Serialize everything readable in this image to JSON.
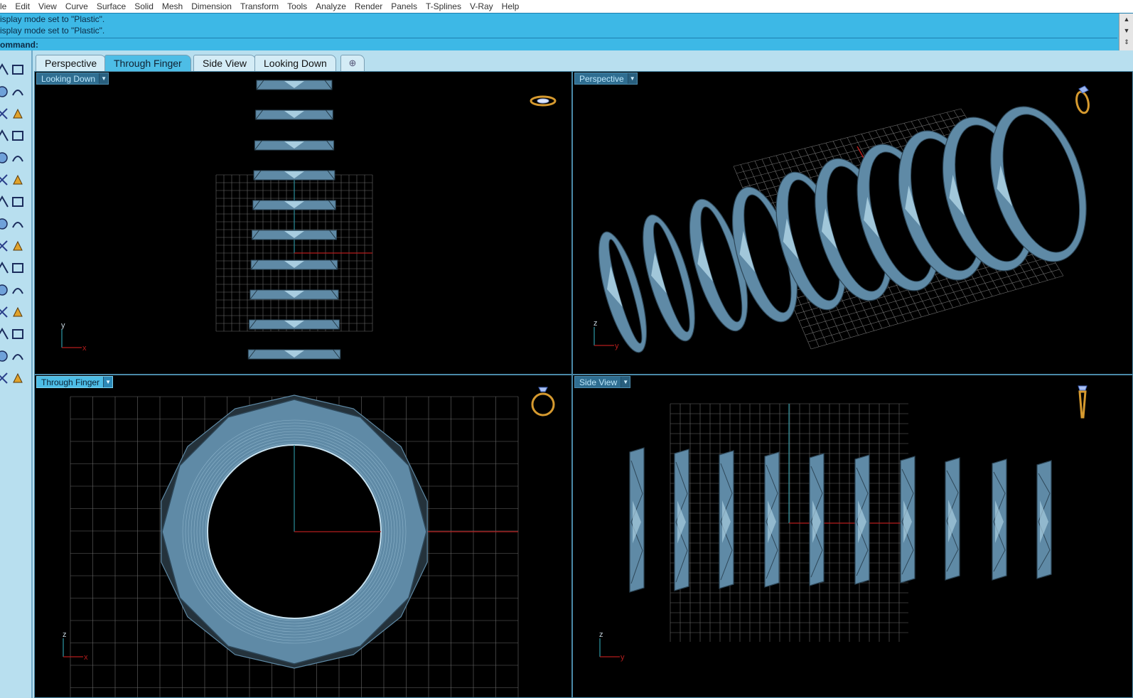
{
  "menu": {
    "items": [
      "le",
      "Edit",
      "View",
      "Curve",
      "Surface",
      "Solid",
      "Mesh",
      "Dimension",
      "Transform",
      "Tools",
      "Analyze",
      "Render",
      "Panels",
      "T-Splines",
      "V-Ray",
      "Help"
    ]
  },
  "command": {
    "history": [
      "isplay mode set to \"Plastic\".",
      "isplay mode set to \"Plastic\"."
    ],
    "prompt": "ommand:",
    "value": ""
  },
  "tabs": {
    "items": [
      "Perspective",
      "Through Finger",
      "Side View",
      "Looking Down"
    ],
    "active": "Through Finger",
    "add_label": "⊕"
  },
  "viewports": {
    "looking_down": {
      "label": "Looking Down",
      "axis_labels": [
        "y",
        "x"
      ]
    },
    "perspective": {
      "label": "Perspective",
      "axis_labels": [
        "z",
        "y"
      ]
    },
    "through_finger": {
      "label": "Through Finger",
      "axis_labels": [
        "z",
        "x"
      ]
    },
    "side_view": {
      "label": "Side View",
      "axis_labels": [
        "z",
        "y"
      ]
    }
  },
  "colors": {
    "ring_fill": "#5f8aa6",
    "ring_light": "#a8cde0",
    "ring_edge": "#2d4657",
    "grid": "#8c8c8c",
    "axis_x": "#b51d1d",
    "axis_y": "#2a8e9a",
    "ui_blue": "#3db8e6",
    "panel": "#b8dfef",
    "nav_gold": "#d69a2f"
  },
  "icons": [
    "viewport-menu-chevron-icon",
    "ring-nav-icon",
    "gem-nav-icon",
    "toolbar-tool-icons"
  ]
}
